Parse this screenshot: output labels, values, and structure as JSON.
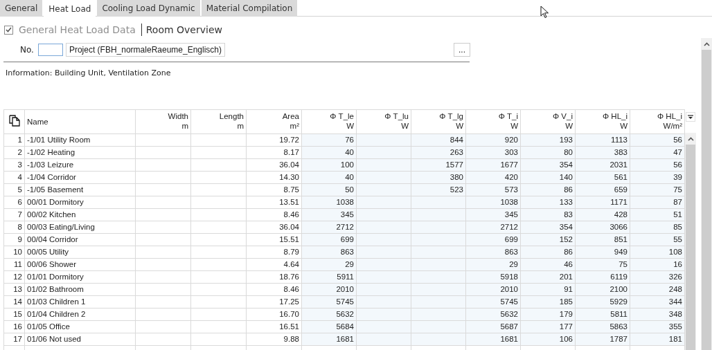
{
  "tabs": [
    {
      "label": "General",
      "selected": false
    },
    {
      "label": "Heat Load",
      "selected": true
    },
    {
      "label": "Cooling Load Dynamic",
      "selected": false
    },
    {
      "label": "Material Compilation",
      "selected": false
    }
  ],
  "header": {
    "checked": true,
    "breadcrumb_parent": "General Heat Load Data",
    "title": "Room Overview"
  },
  "number_field": {
    "label": "No."
  },
  "project_field": {
    "value": "Project (FBH_normaleRaeume_Englisch)"
  },
  "browse_button": "...",
  "info": "Information: Building Unit, Ventilation Zone",
  "table": {
    "columns": [
      {
        "title": "Name",
        "shaded": false
      },
      {
        "title": "Width",
        "unit": "m",
        "shaded": false
      },
      {
        "title": "Length",
        "unit": "m",
        "shaded": false
      },
      {
        "title": "Area",
        "unit": "m²",
        "shaded": false
      },
      {
        "title": "Φ T_le",
        "unit": "W",
        "shaded": true
      },
      {
        "title": "Φ T_lu",
        "unit": "W",
        "shaded": true
      },
      {
        "title": "Φ T_lg",
        "unit": "W",
        "shaded": true
      },
      {
        "title": "Φ T_i",
        "unit": "W",
        "shaded": true
      },
      {
        "title": "Φ V_i",
        "unit": "W",
        "shaded": true
      },
      {
        "title": "Φ HL_i",
        "unit": "W",
        "shaded": true
      },
      {
        "title": "Φ HL_i",
        "unit": "W/m²",
        "shaded": true
      }
    ],
    "rows": [
      {
        "no": "1",
        "name": "-1/01 Utility Room",
        "area": "19.72",
        "t_le": "76",
        "t_lg": "844",
        "t_i": "920",
        "v_i": "193",
        "hl_i": "1113",
        "hl_i_m2": "56"
      },
      {
        "no": "2",
        "name": "-1/02 Heating",
        "area": "8.17",
        "t_le": "40",
        "t_lg": "263",
        "t_i": "303",
        "v_i": "80",
        "hl_i": "383",
        "hl_i_m2": "47"
      },
      {
        "no": "3",
        "name": "-1/03 Leizure",
        "area": "36.04",
        "t_le": "100",
        "t_lg": "1577",
        "t_i": "1677",
        "v_i": "354",
        "hl_i": "2031",
        "hl_i_m2": "56"
      },
      {
        "no": "4",
        "name": "-1/04 Corridor",
        "area": "14.30",
        "t_le": "40",
        "t_lg": "380",
        "t_i": "420",
        "v_i": "140",
        "hl_i": "561",
        "hl_i_m2": "39"
      },
      {
        "no": "5",
        "name": "-1/05 Basement",
        "area": "8.75",
        "t_le": "50",
        "t_lg": "523",
        "t_i": "573",
        "v_i": "86",
        "hl_i": "659",
        "hl_i_m2": "75"
      },
      {
        "no": "6",
        "name": "00/01 Dormitory",
        "area": "13.51",
        "t_le": "1038",
        "t_i": "1038",
        "v_i": "133",
        "hl_i": "1171",
        "hl_i_m2": "87"
      },
      {
        "no": "7",
        "name": "00/02 Kitchen",
        "area": "8.46",
        "t_le": "345",
        "t_i": "345",
        "v_i": "83",
        "hl_i": "428",
        "hl_i_m2": "51"
      },
      {
        "no": "8",
        "name": "00/03 Eating/Living",
        "area": "36.04",
        "t_le": "2712",
        "t_i": "2712",
        "v_i": "354",
        "hl_i": "3066",
        "hl_i_m2": "85"
      },
      {
        "no": "9",
        "name": "00/04 Corridor",
        "area": "15.51",
        "t_le": "699",
        "t_i": "699",
        "v_i": "152",
        "hl_i": "851",
        "hl_i_m2": "55"
      },
      {
        "no": "10",
        "name": "00/05 Utility",
        "area": "8.79",
        "t_le": "863",
        "t_i": "863",
        "v_i": "86",
        "hl_i": "949",
        "hl_i_m2": "108"
      },
      {
        "no": "11",
        "name": "00/06 Shower",
        "area": "4.64",
        "t_le": "29",
        "t_i": "29",
        "v_i": "46",
        "hl_i": "75",
        "hl_i_m2": "16"
      },
      {
        "no": "12",
        "name": "01/01 Dormitory",
        "area": "18.76",
        "t_le": "5911",
        "t_i": "5918",
        "v_i": "201",
        "hl_i": "6119",
        "hl_i_m2": "326"
      },
      {
        "no": "13",
        "name": "01/02 Bathroom",
        "area": "8.46",
        "t_le": "2010",
        "t_i": "2010",
        "v_i": "91",
        "hl_i": "2100",
        "hl_i_m2": "248"
      },
      {
        "no": "14",
        "name": "01/03 Children 1",
        "area": "17.25",
        "t_le": "5745",
        "t_i": "5745",
        "v_i": "185",
        "hl_i": "5929",
        "hl_i_m2": "344"
      },
      {
        "no": "15",
        "name": "01/04 Children 2",
        "area": "16.70",
        "t_le": "5632",
        "t_i": "5632",
        "v_i": "179",
        "hl_i": "5811",
        "hl_i_m2": "348"
      },
      {
        "no": "16",
        "name": "01/05 Office",
        "area": "16.51",
        "t_le": "5684",
        "t_i": "5687",
        "v_i": "177",
        "hl_i": "5863",
        "hl_i_m2": "355"
      },
      {
        "no": "17",
        "name": "01/06 Not used",
        "area": "9.88",
        "t_le": "1681",
        "t_i": "1681",
        "v_i": "106",
        "hl_i": "1787",
        "hl_i_m2": "181"
      }
    ]
  }
}
